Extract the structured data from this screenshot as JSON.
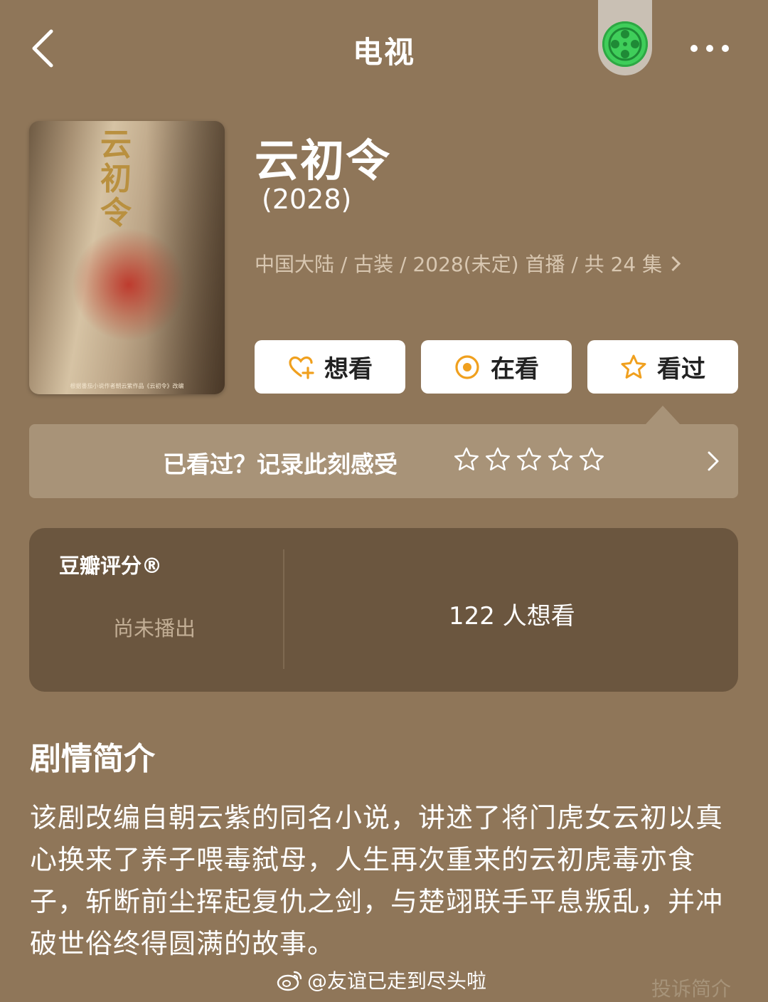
{
  "header": {
    "title": "电视",
    "back_icon": "chevron-left-icon",
    "app_icon": "film-reel-icon",
    "more_icon": "more-dots-icon"
  },
  "poster": {
    "title_text": "云初令",
    "caption": "根据番茄小说作者朝云紫作品《云初令》改编"
  },
  "show": {
    "title": "云初令",
    "year": "(2028)",
    "meta": "中国大陆 / 古装 / 2028(未定) 首播 / 共 24 集"
  },
  "actions": [
    {
      "label": "想看",
      "icon": "heart-plus-icon"
    },
    {
      "label": "在看",
      "icon": "target-icon"
    },
    {
      "label": "看过",
      "icon": "star-icon"
    }
  ],
  "record": {
    "text": "已看过？记录此刻感受",
    "stars_filled": 0,
    "stars_total": 5
  },
  "rating": {
    "label": "豆瓣评分®",
    "status": "尚未播出",
    "want_count": "122 人想看"
  },
  "synopsis": {
    "title": "剧情简介",
    "text": "该剧改编自朝云紫的同名小说，讲述了将门虎女云初以真心换来了养子喂毒弑母，人生再次重来的云初虎毒亦食子，斩断前尘挥起复仇之剑，与楚翊联手平息叛乱，并冲破世俗终得圆满的故事。"
  },
  "footer": {
    "watermark": "@友谊已走到尽头啦",
    "report_link": "投诉简介"
  },
  "colors": {
    "background": "#8f7659",
    "card": "#6b563f",
    "panel": "#a89378",
    "accent": "#f0a01e",
    "app_green": "#3fce5a"
  }
}
